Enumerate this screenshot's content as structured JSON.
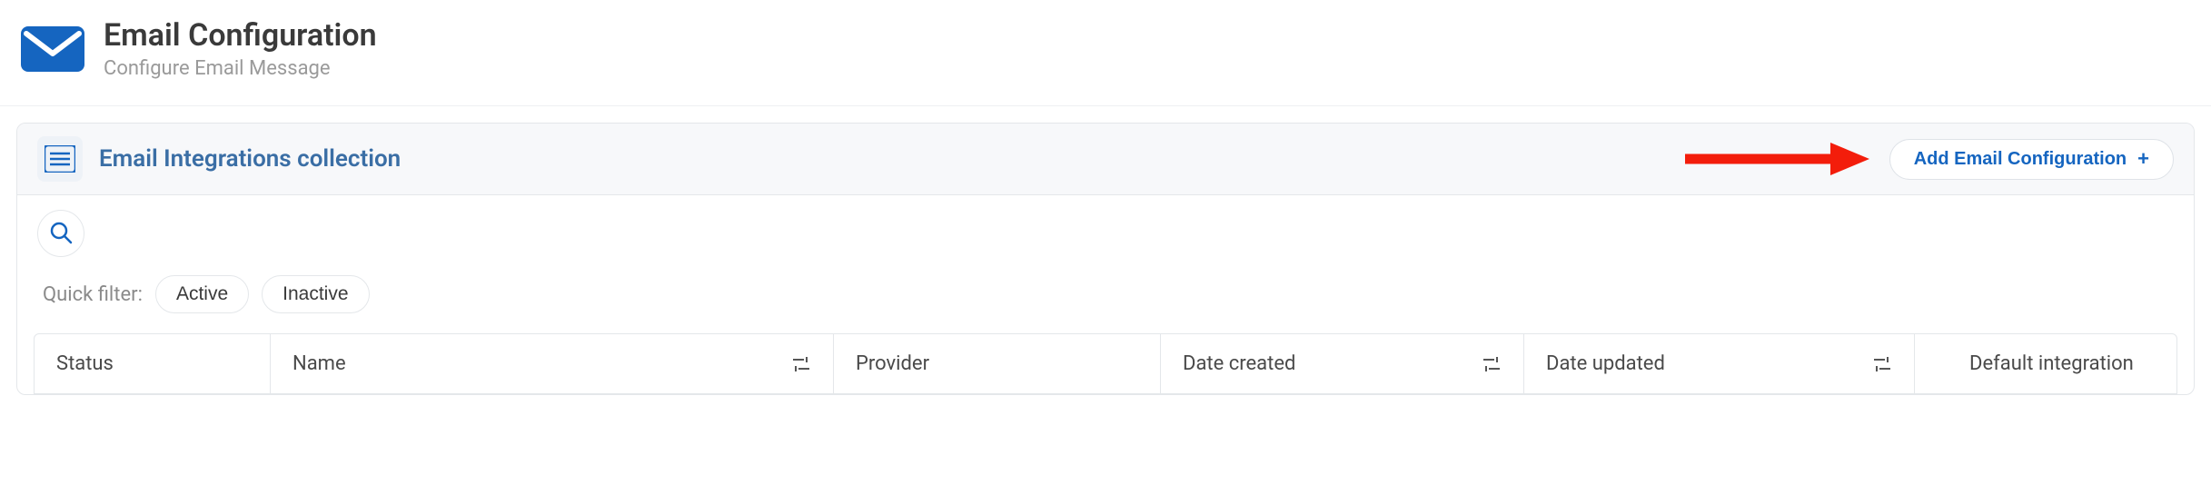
{
  "header": {
    "title": "Email Configuration",
    "subtitle": "Configure Email Message"
  },
  "panel": {
    "title": "Email Integrations collection",
    "add_button_label": "Add Email Configuration"
  },
  "quick_filter": {
    "label": "Quick filter:",
    "chips": [
      "Active",
      "Inactive"
    ]
  },
  "table": {
    "columns": [
      {
        "key": "status",
        "label": "Status",
        "filterable": false
      },
      {
        "key": "name",
        "label": "Name",
        "filterable": true
      },
      {
        "key": "provider",
        "label": "Provider",
        "filterable": false
      },
      {
        "key": "created",
        "label": "Date created",
        "filterable": true
      },
      {
        "key": "updated",
        "label": "Date updated",
        "filterable": true
      },
      {
        "key": "default",
        "label": "Default integration",
        "filterable": false
      }
    ]
  },
  "colors": {
    "accent": "#1565c0",
    "panel_title": "#3a6ea5",
    "annotation_arrow": "#f31d0b"
  }
}
